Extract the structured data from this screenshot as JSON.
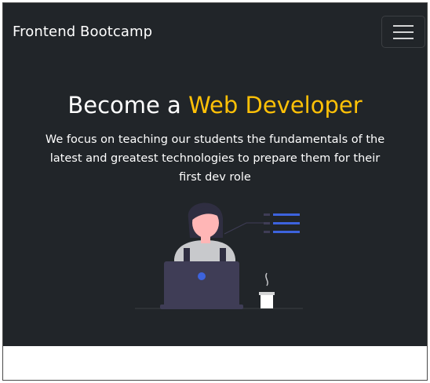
{
  "navbar": {
    "brand": "Frontend Bootcamp",
    "toggler_icon": "hamburger-menu-icon"
  },
  "hero": {
    "headline_prefix": "Become a ",
    "headline_accent": "Web Developer",
    "lead": "We focus on teaching our students the fundamentals of the latest and greatest technologies to prepare them for their first dev role",
    "illustration_icon": "developer-at-laptop-illustration"
  },
  "colors": {
    "hero_background": "#212529",
    "accent": "#ffc107",
    "illustration_blue": "#3d63dd"
  }
}
